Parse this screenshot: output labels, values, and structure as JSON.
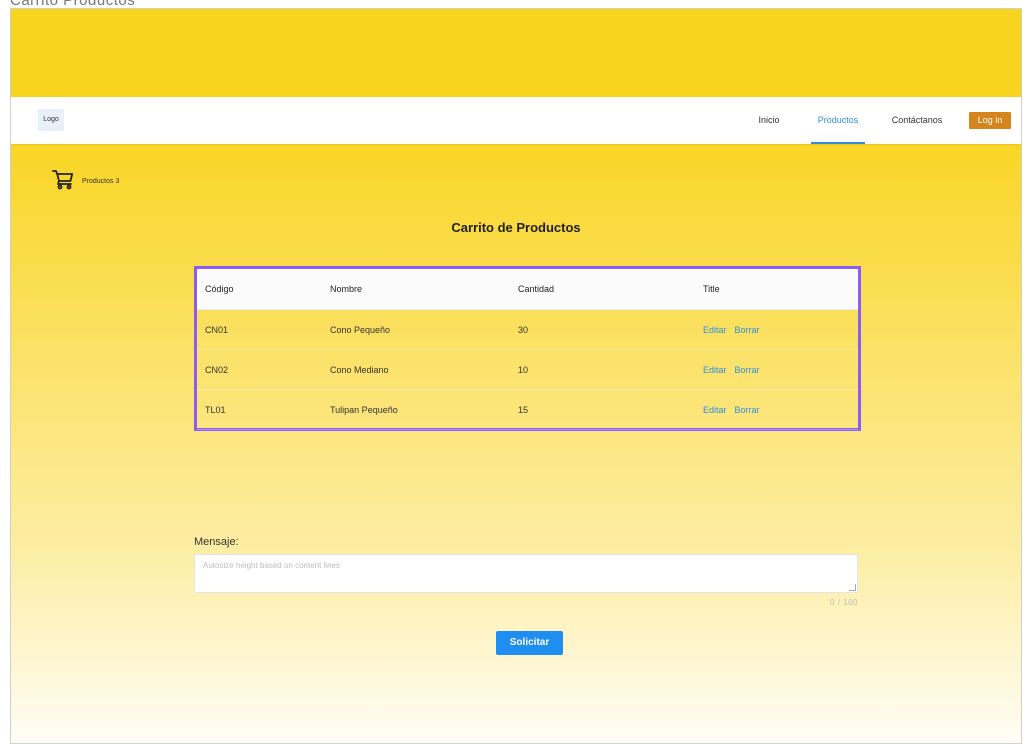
{
  "window": {
    "title": "Carrito Productos"
  },
  "navbar": {
    "logo": "Logo",
    "items": [
      {
        "label": "Inicio",
        "active": false
      },
      {
        "label": "Productos",
        "active": true
      },
      {
        "label": "Contáctanos",
        "active": false
      }
    ],
    "login_label": "Log in"
  },
  "cart": {
    "icon": "cart-icon",
    "label": "Productos 3"
  },
  "page_title": "Carrito de Productos",
  "table": {
    "columns": [
      "Código",
      "Nombre",
      "Cantidad",
      "Title"
    ],
    "rows": [
      {
        "codigo": "CN01",
        "nombre": "Cono Pequeño",
        "cantidad": "30",
        "edit": "Editar",
        "delete": "Borrar"
      },
      {
        "codigo": "CN02",
        "nombre": "Cono Mediano",
        "cantidad": "10",
        "edit": "Editar",
        "delete": "Borrar"
      },
      {
        "codigo": "TL01",
        "nombre": "Tulipan Pequeño",
        "cantidad": "15",
        "edit": "Editar",
        "delete": "Borrar"
      }
    ]
  },
  "message": {
    "label": "Mensaje:",
    "value": "",
    "placeholder": "Autosize height based on content lines",
    "counter": "0 / 100"
  },
  "submit_label": "Solicitar",
  "colors": {
    "primary_yellow": "#f8d41f",
    "link_blue": "#2f8fdc",
    "login_orange": "#d4861c",
    "button_blue": "#1f8ef1",
    "table_border_purple": "#8b5cf6"
  }
}
